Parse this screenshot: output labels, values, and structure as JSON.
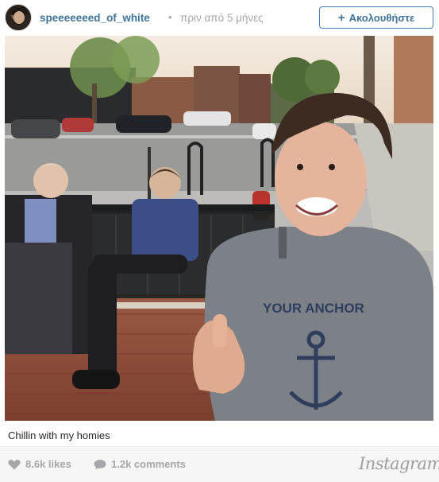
{
  "post": {
    "username": "speeeeeeed_of_white",
    "separator": "•",
    "time_ago": "πριν από 5 μήνες",
    "follow_label": "Ακολουθήστε",
    "follow_icon": "plus-icon",
    "caption": "Chillin with my homies"
  },
  "photo": {
    "shirt_text": "YOUR ANCHOR"
  },
  "footer": {
    "likes": "8.6k likes",
    "comments": "1.2k comments",
    "brand": "Instagram",
    "like_icon": "heart-icon",
    "comment_icon": "speech-bubble-icon"
  },
  "colors": {
    "accent": "#3f729b",
    "muted": "#a5a7aa",
    "footer_bg": "#f6f6f6"
  }
}
